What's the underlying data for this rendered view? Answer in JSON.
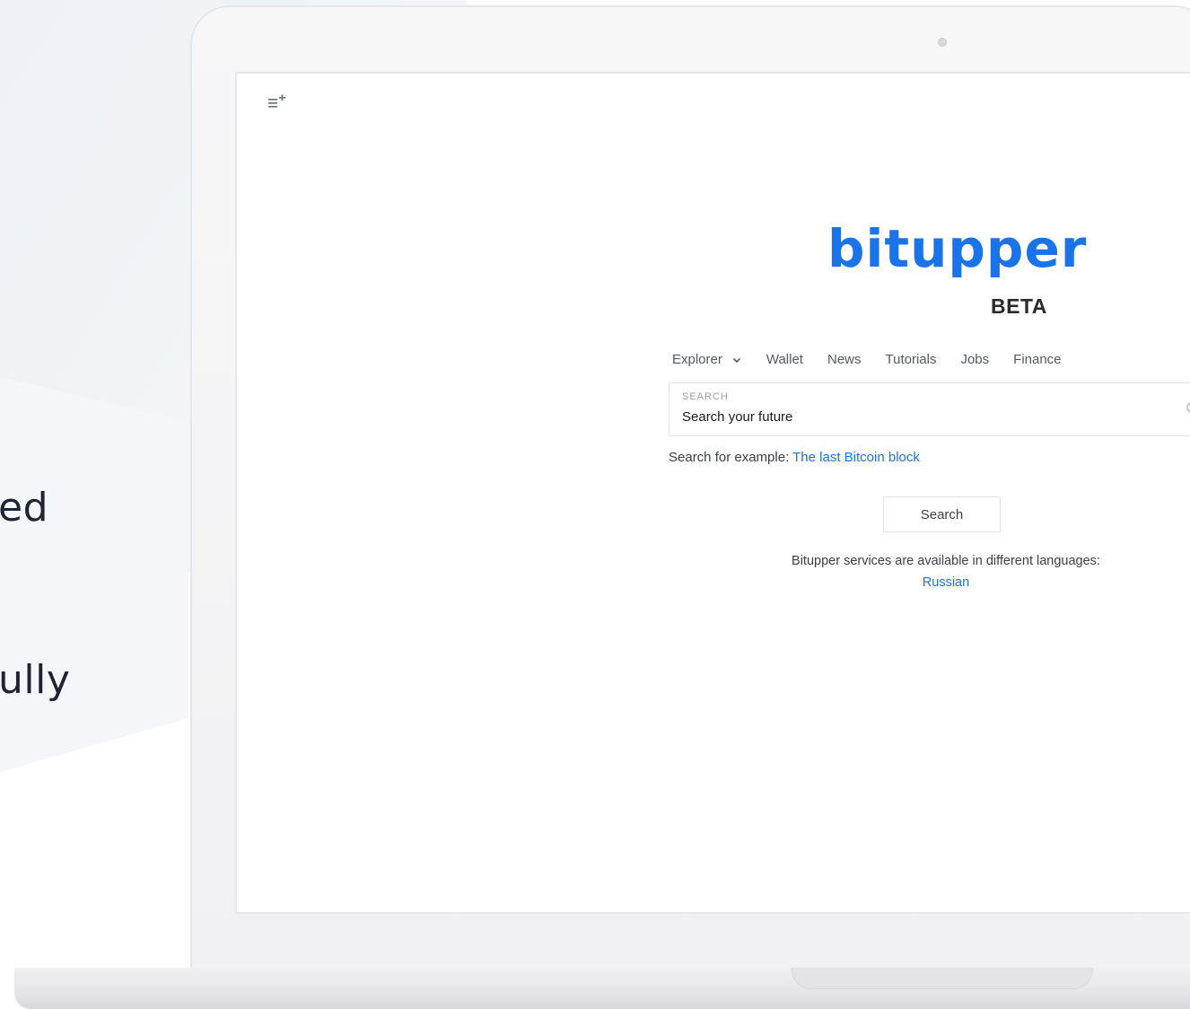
{
  "marketing": {
    "fragment_1": "ed",
    "fragment_2": "ully"
  },
  "app": {
    "logo": "bitupper",
    "badge": "BETA",
    "menu_icon": "menu-add-icon",
    "nav": {
      "items": [
        {
          "label": "Explorer",
          "has_dropdown": true
        },
        {
          "label": "Wallet"
        },
        {
          "label": "News"
        },
        {
          "label": "Tutorials"
        },
        {
          "label": "Jobs"
        },
        {
          "label": "Finance"
        }
      ]
    },
    "search": {
      "label": "SEARCH",
      "placeholder": "Search your future",
      "example_prefix": "Search for example: ",
      "example_link": "The last Bitcoin block",
      "button_label": "Search"
    },
    "languages": {
      "text": "Bitupper services are available in different languages:",
      "link": "Russian"
    }
  },
  "colors": {
    "brand_blue": "#1a73e8",
    "text_dark": "#1e2433",
    "background_wave": "#f3f5f8"
  }
}
